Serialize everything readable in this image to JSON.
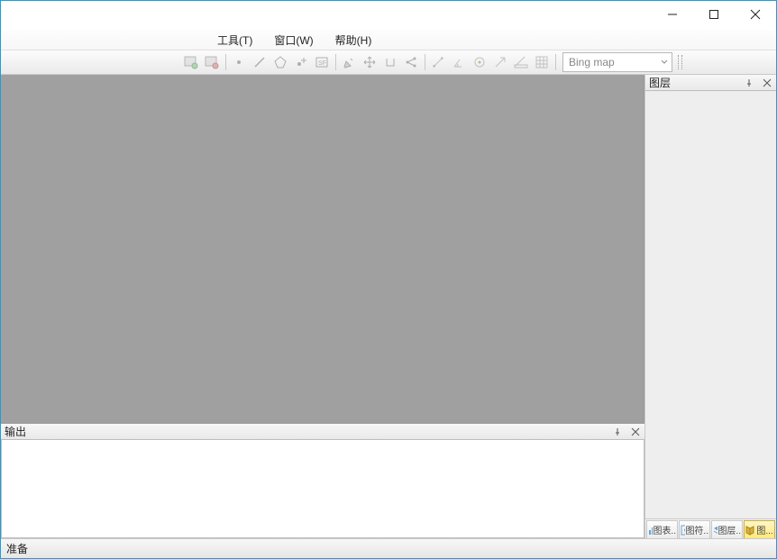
{
  "window": {
    "title": ""
  },
  "menu": {
    "tools": "工具(T)",
    "window": "窗口(W)",
    "help": "帮助(H)"
  },
  "toolbar": {
    "map_selector": {
      "value": "Bing map"
    }
  },
  "panels": {
    "layers": {
      "title": "图层",
      "tabs": [
        "图表..",
        "图符..",
        "图层..",
        "图..."
      ]
    },
    "output": {
      "title": "输出"
    }
  },
  "status": {
    "text": "准备"
  }
}
